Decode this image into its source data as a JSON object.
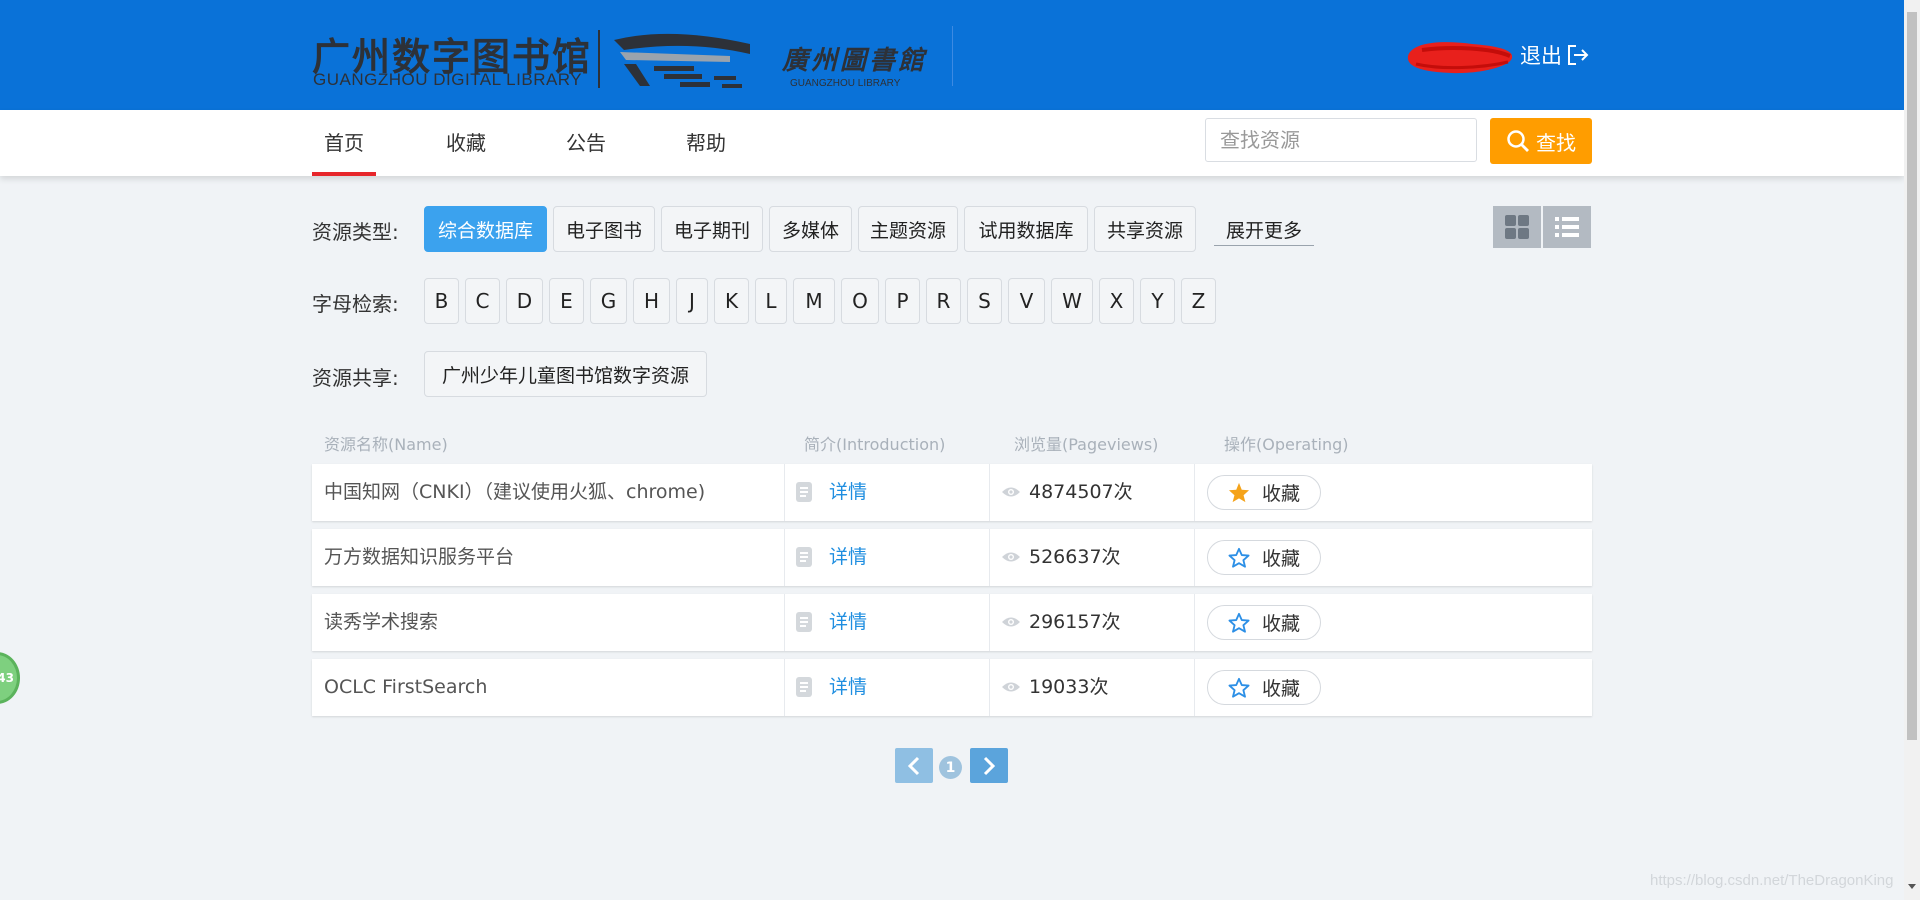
{
  "header": {
    "logo_cn": "广州数字图书馆",
    "logo_en": "GUANGZHOU DIGITAL LIBRARY",
    "logo_cn2": "廣州圖書館",
    "logo_en2": "GUANGZHOU LIBRARY",
    "logout_label": "退出",
    "brand_color": "#0a72d8"
  },
  "nav": {
    "items": [
      {
        "label": "首页",
        "active": true
      },
      {
        "label": "收藏"
      },
      {
        "label": "公告"
      },
      {
        "label": "帮助"
      }
    ],
    "search_placeholder": "查找资源",
    "search_button": "查找",
    "search_button_color": "#ff9d00"
  },
  "filters": {
    "type_label": "资源类型:",
    "types": [
      "综合数据库",
      "电子图书",
      "电子期刊",
      "多媒体",
      "主题资源",
      "试用数据库",
      "共享资源"
    ],
    "active_type": "综合数据库",
    "more_label": "展开更多",
    "letter_label": "字母检索:",
    "letters": [
      "B",
      "C",
      "D",
      "E",
      "G",
      "H",
      "J",
      "K",
      "L",
      "M",
      "O",
      "P",
      "R",
      "S",
      "V",
      "W",
      "X",
      "Y",
      "Z"
    ],
    "share_label": "资源共享:",
    "shares": [
      "广州少年儿童图书馆数字资源"
    ]
  },
  "table": {
    "headers": [
      "资源名称(Name)",
      "简介(Introduction)",
      "浏览量(Pageviews)",
      "操作(Operating)"
    ],
    "rows": [
      {
        "name": "中国知网（CNKI）（建议使用火狐、chrome)",
        "detail": "详情",
        "views": "4874507次",
        "fav_label": "收藏",
        "favorited": true
      },
      {
        "name": "万方数据知识服务平台",
        "detail": "详情",
        "views": "526637次",
        "fav_label": "收藏",
        "favorited": false
      },
      {
        "name": "读秀学术搜索",
        "detail": "详情",
        "views": "296157次",
        "fav_label": "收藏",
        "favorited": false
      },
      {
        "name": "OCLC FirstSearch",
        "detail": "详情",
        "views": "19033次",
        "fav_label": "收藏",
        "favorited": false
      }
    ]
  },
  "pagination": {
    "current_page": "1"
  },
  "side_badge": "43",
  "watermark": "https://blog.csdn.net/TheDragonKing",
  "colors": {
    "accent_blue": "#3ba2ee",
    "star_filled": "#f5a31a",
    "active_underline": "#e7262b"
  }
}
